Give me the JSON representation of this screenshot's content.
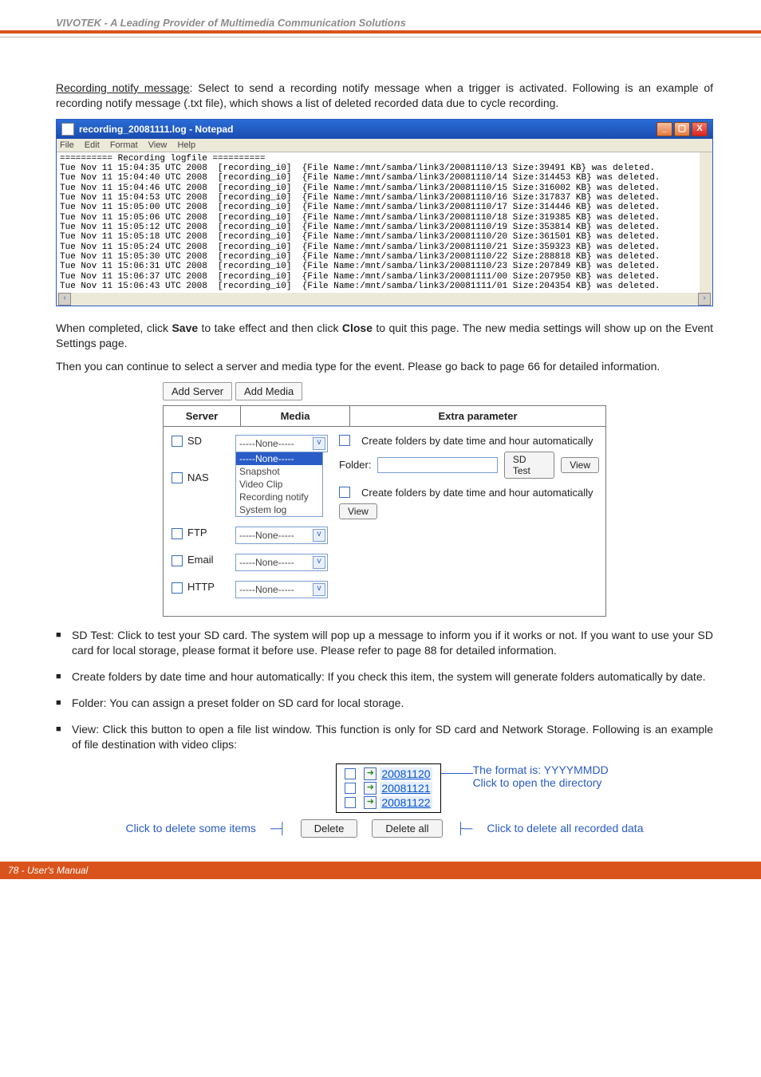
{
  "header": {
    "brand": "VIVOTEK - A Leading Provider of Multimedia Communication Solutions"
  },
  "intro": {
    "lead": "Recording notify message",
    "rest": ": Select to send a recording notify message when a trigger is activated. Following is an example of recording notify message (.txt file), which shows a list of deleted recorded data due to cycle recording."
  },
  "notepad": {
    "title": "recording_20081111.log - Notepad",
    "menu": [
      "File",
      "Edit",
      "Format",
      "View",
      "Help"
    ],
    "header_line": "========== Recording logfile ==========",
    "lines": [
      "Tue Nov 11 15:04:35 UTC 2008  [recording_i0]  {File Name:/mnt/samba/link3/20081110/13 Size:39491 KB} was deleted.",
      "Tue Nov 11 15:04:40 UTC 2008  [recording_i0]  {File Name:/mnt/samba/link3/20081110/14 Size:314453 KB} was deleted.",
      "Tue Nov 11 15:04:46 UTC 2008  [recording_i0]  {File Name:/mnt/samba/link3/20081110/15 Size:316002 KB} was deleted.",
      "Tue Nov 11 15:04:53 UTC 2008  [recording_i0]  {File Name:/mnt/samba/link3/20081110/16 Size:317837 KB} was deleted.",
      "Tue Nov 11 15:05:00 UTC 2008  [recording_i0]  {File Name:/mnt/samba/link3/20081110/17 Size:314446 KB} was deleted.",
      "Tue Nov 11 15:05:06 UTC 2008  [recording_i0]  {File Name:/mnt/samba/link3/20081110/18 Size:319385 KB} was deleted.",
      "Tue Nov 11 15:05:12 UTC 2008  [recording_i0]  {File Name:/mnt/samba/link3/20081110/19 Size:353814 KB} was deleted.",
      "Tue Nov 11 15:05:18 UTC 2008  [recording_i0]  {File Name:/mnt/samba/link3/20081110/20 Size:361501 KB} was deleted.",
      "Tue Nov 11 15:05:24 UTC 2008  [recording_i0]  {File Name:/mnt/samba/link3/20081110/21 Size:359323 KB} was deleted.",
      "Tue Nov 11 15:05:30 UTC 2008  [recording_i0]  {File Name:/mnt/samba/link3/20081110/22 Size:288818 KB} was deleted.",
      "Tue Nov 11 15:06:31 UTC 2008  [recording_i0]  {File Name:/mnt/samba/link3/20081110/23 Size:207849 KB} was deleted.",
      "Tue Nov 11 15:06:37 UTC 2008  [recording_i0]  {File Name:/mnt/samba/link3/20081111/00 Size:207950 KB} was deleted.",
      "Tue Nov 11 15:06:43 UTC 2008  [recording_i0]  {File Name:/mnt/samba/link3/20081111/01 Size:204354 KB} was deleted."
    ]
  },
  "mid1": {
    "pre": "When completed, click ",
    "save": "Save",
    "mid": " to take effect and then click ",
    "close": "Close",
    "post": " to quit this page. The new media settings will show up on the Event Settings page."
  },
  "mid2": "Then you can continue to select a server and media type for the event. Please go back to page 66 for detailed information.",
  "server_media": {
    "buttons": {
      "add_server": "Add Server",
      "add_media": "Add Media"
    },
    "headers": {
      "server": "Server",
      "media": "Media",
      "extra": "Extra parameter"
    },
    "rows": {
      "sd": {
        "label": "SD",
        "sel": "-----None-----"
      },
      "nas": {
        "label": "NAS"
      },
      "ftp": {
        "label": "FTP",
        "sel": "-----None-----"
      },
      "email": {
        "label": "Email",
        "sel": "-----None-----"
      },
      "http": {
        "label": "HTTP",
        "sel": "-----None-----"
      }
    },
    "dropdown_options": [
      "-----None-----",
      "Snapshot",
      "Video Clip",
      "Recording notify",
      "System log"
    ],
    "extra": {
      "line1": "Create folders by date time and hour automatically",
      "folder_label": "Folder:",
      "sd_test": "SD Test",
      "view": "View",
      "line2": "Create folders by date time and hour automatically"
    }
  },
  "bullets": {
    "b1": "SD Test: Click to test your SD card. The system will pop up a message to inform you if it works or not. If you want to use your SD card for local storage, please format it before use. Please refer to page 88 for detailed information.",
    "b2": "Create folders by date time and hour automatically: If you check this item, the system will generate folders automatically by date.",
    "b3": "Folder: You can assign a preset folder on SD card for local storage.",
    "b4": "View: Click this button to open a file list window. This function is only for SD card and Network Storage. Following is an example of file destination with video clips:"
  },
  "dirlist": {
    "items": [
      "20081120",
      "20081121",
      "20081122"
    ],
    "ann_format": "The format is: YYYYMMDD",
    "ann_open": "Click to open the directory",
    "delete": "Delete",
    "delete_all": "Delete all",
    "ann_del_left": "Click to delete some items",
    "ann_del_right": "Click to delete all recorded data"
  },
  "footer": "78 - User's Manual"
}
